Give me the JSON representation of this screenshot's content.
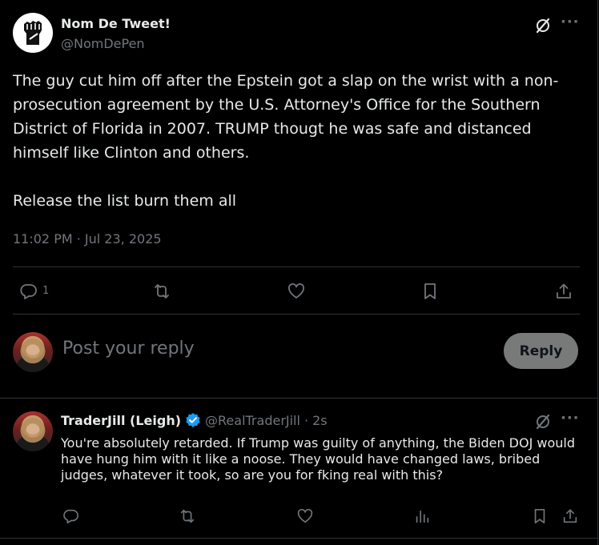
{
  "tweet": {
    "author_name": "Nom De Tweet!",
    "author_handle": "@NomDePen",
    "text": "The guy cut him off after the Epstein got a slap on the wrist with a non-prosecution agreement by the U.S. Attorney's Office for the Southern District of Florida in 2007. TRUMP thougt he was safe and distanced himself like Clinton and others.\n\nRelease the list burn them all",
    "timestamp": "11:02 PM · Jul 23, 2025",
    "reply_count": "1",
    "more_label": "···"
  },
  "composer": {
    "placeholder": "Post your reply",
    "reply_button": "Reply"
  },
  "reply": {
    "author_name": "TraderJill (Leigh)",
    "author_handle": "@RealTraderJill",
    "time": "· 2s",
    "text": "You're absolutely retarded. If Trump was guilty of anything, the Biden DOJ would have hung him with it like a noose. They would have changed laws, bribed judges, whatever it took, so are you for fking real with this?",
    "more_label": "···"
  },
  "colors": {
    "background": "#000000",
    "text": "#e7e9ea",
    "secondary": "#71767b",
    "divider": "#2f3336",
    "verified": "#1d9bf0"
  }
}
